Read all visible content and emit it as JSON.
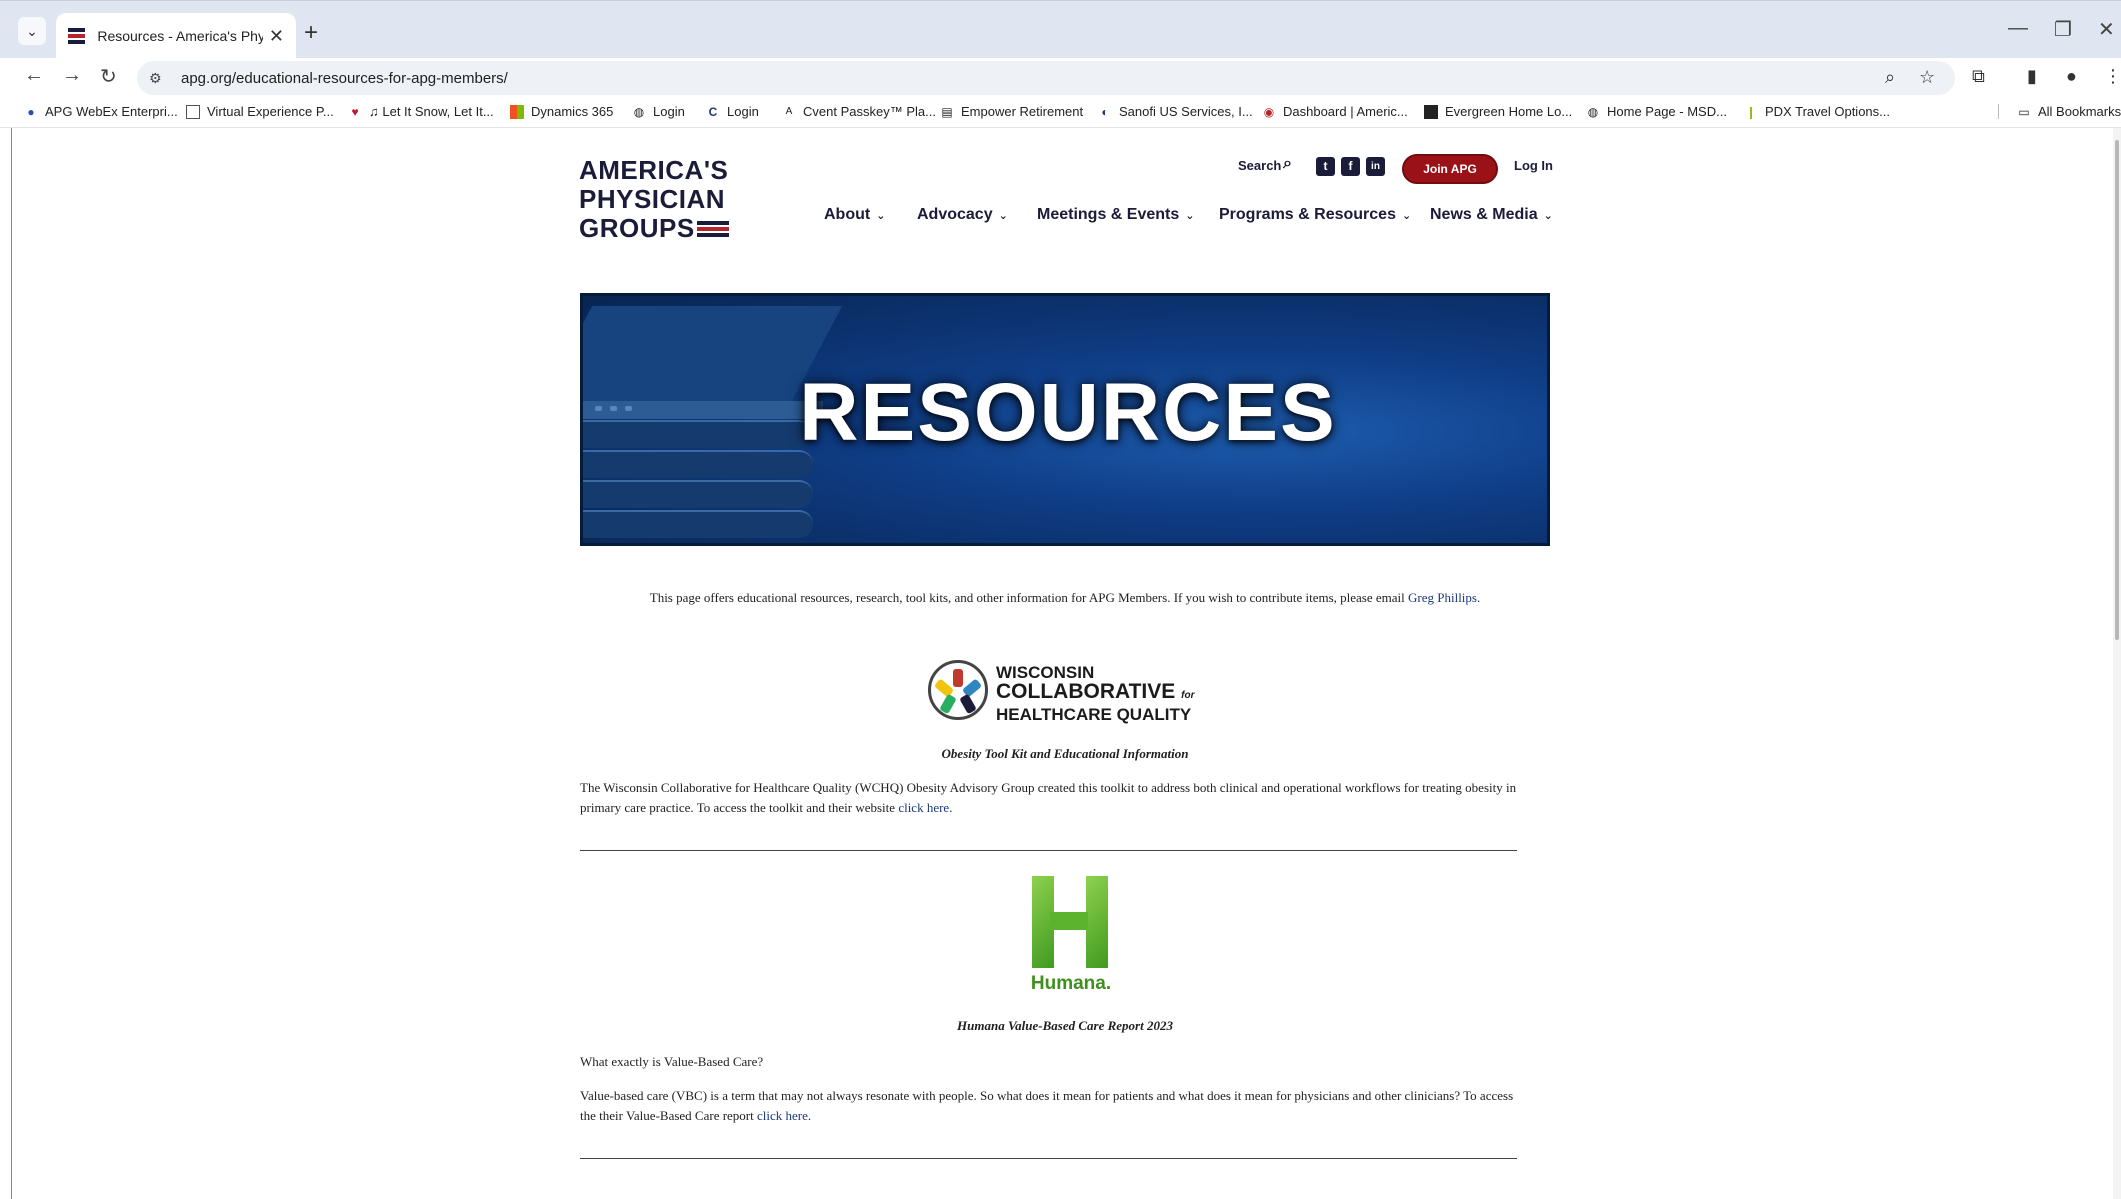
{
  "browser": {
    "tab_title": "Resources - America's Physician",
    "tab_close": "✕",
    "new_tab": "+",
    "url": "apg.org/educational-resources-for-apg-members/",
    "bookmarks": [
      {
        "label": "APG WebEx Enterpri...",
        "icon": "webex-icon"
      },
      {
        "label": "Virtual Experience P...",
        "icon": "page-icon"
      },
      {
        "label": "♫ Let It Snow, Let It...",
        "icon": "iheart-icon"
      },
      {
        "label": "Dynamics 365",
        "icon": "microsoft-icon"
      },
      {
        "label": "Login",
        "icon": "globe-icon"
      },
      {
        "label": "Login",
        "icon": "c-logo-icon"
      },
      {
        "label": "Cvent Passkey™ Pla...",
        "icon": "cvent-icon"
      },
      {
        "label": "Empower Retirement",
        "icon": "empower-icon"
      },
      {
        "label": "Sanofi US Services, I...",
        "icon": "sanofi-icon"
      },
      {
        "label": "Dashboard | Americ...",
        "icon": "dashboard-icon"
      },
      {
        "label": "Evergreen Home Lo...",
        "icon": "evergreen-icon"
      },
      {
        "label": "Home Page - MSD...",
        "icon": "globe-icon"
      },
      {
        "label": "PDX Travel Options...",
        "icon": "pdx-icon"
      }
    ],
    "all_bookmarks": "All Bookmarks"
  },
  "site": {
    "logo_lines": [
      "AMERICA'S",
      "PHYSICIAN",
      "GROUPS"
    ],
    "search_label": "Search",
    "join_label": "Join APG",
    "login_label": "Log In",
    "social": {
      "twitter": "t",
      "facebook": "f",
      "linkedin": "in"
    },
    "nav": [
      "About",
      "Advocacy",
      "Meetings & Events",
      "Programs & Resources",
      "News & Media"
    ],
    "hero_title": "RESOURCES",
    "intro_text": "This page offers educational resources, research, tool kits, and other information for APG Members. If you wish to contribute items, please email ",
    "intro_link": "Greg Phillips",
    "intro_end": "."
  },
  "items": [
    {
      "logo_lines": [
        "WISCONSIN",
        "COLLABORATIVE",
        "HEALTHCARE QUALITY"
      ],
      "logo_for": "for",
      "caption": "Obesity Tool Kit and Educational Information",
      "body": "The Wisconsin Collaborative for Healthcare Quality (WCHQ) Obesity Advisory Group created this toolkit to address both clinical and operational workflows for treating obesity in primary care practice. To access the toolkit and their website ",
      "link": "click here",
      "end": "."
    },
    {
      "logo_word": "Humana.",
      "caption": "Humana Value-Based Care Report 2023",
      "question": "What exactly is Value-Based Care?",
      "body": "Value-based care (VBC) is a term that may not always resonate with people.  So what does it mean for patients and what does it mean for physicians and other clinicians?  To access the their Value-Based Care report ",
      "link": "click here",
      "end": "."
    }
  ],
  "colors": {
    "navy": "#1b1b3a",
    "join_red": "#9b1118",
    "link": "#1b3a7a",
    "humana_green": "#5cb32e"
  }
}
